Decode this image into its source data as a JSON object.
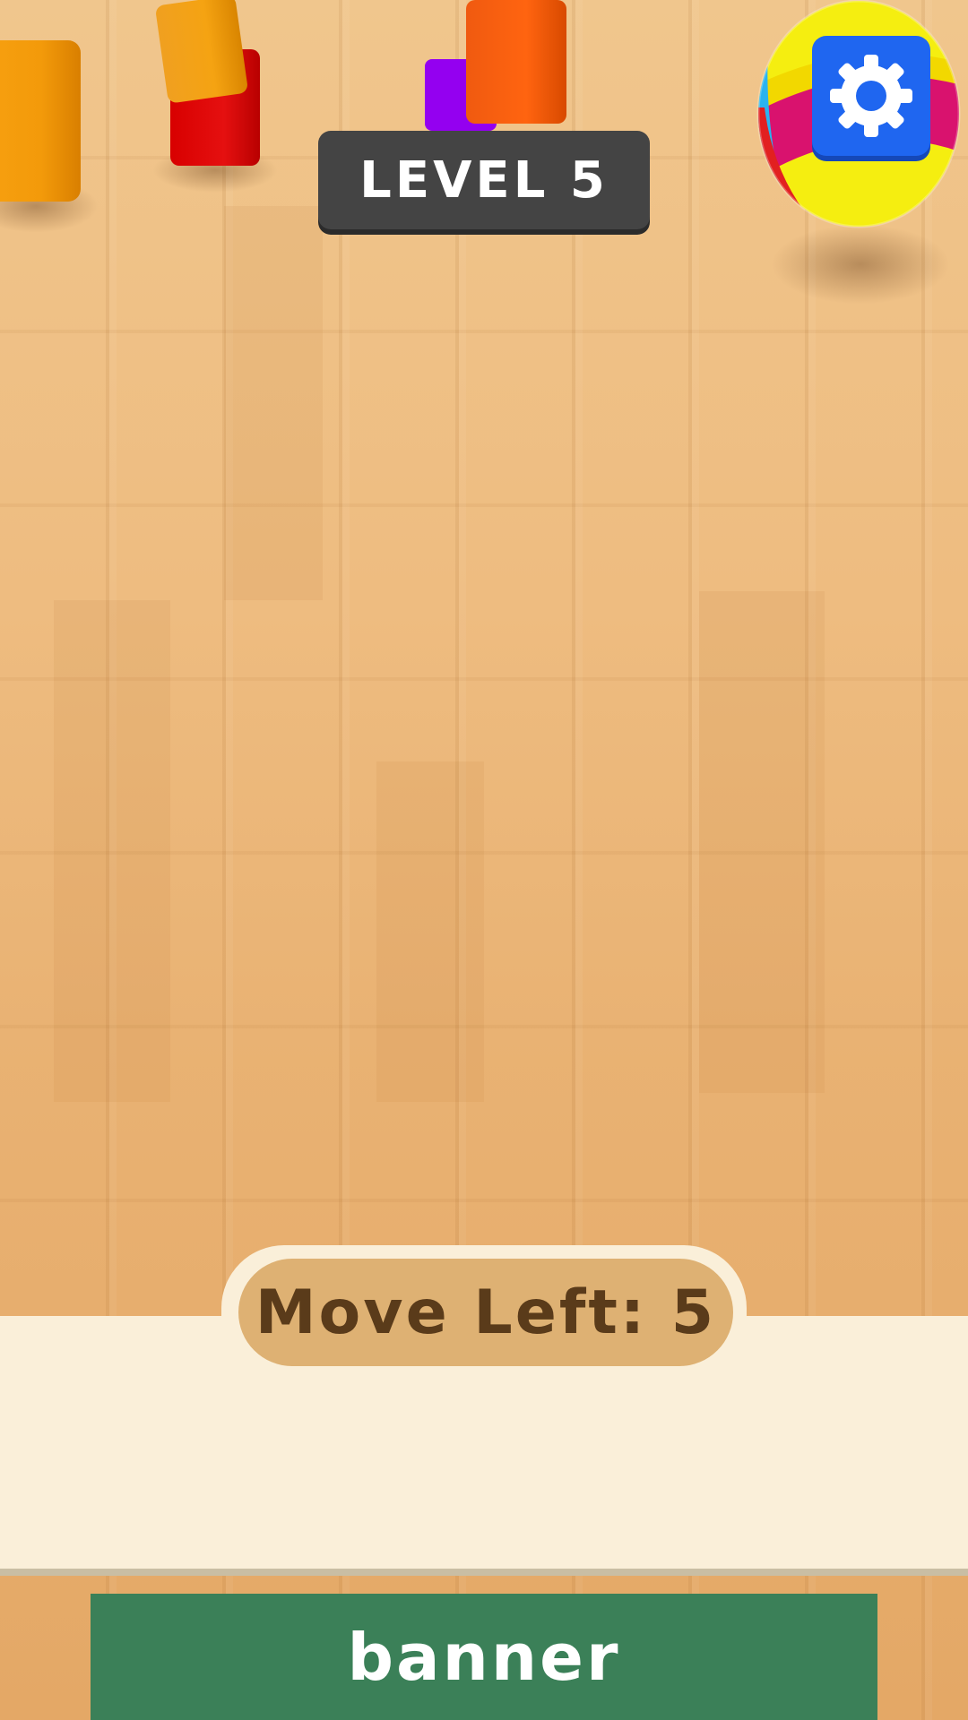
{
  "hud": {
    "level_label": "LEVEL 5",
    "settings_icon": "gear-icon"
  },
  "footer": {
    "moves_label": "Move Left: 5"
  },
  "ad": {
    "banner_label": "banner"
  },
  "colors": {
    "level_bg": "#444444",
    "settings_bg": "#1f66f0",
    "moves_bg": "#deb173",
    "moves_text": "#5a3b1a",
    "panel_bg": "#faefd9",
    "banner_bg": "#3b8058"
  }
}
